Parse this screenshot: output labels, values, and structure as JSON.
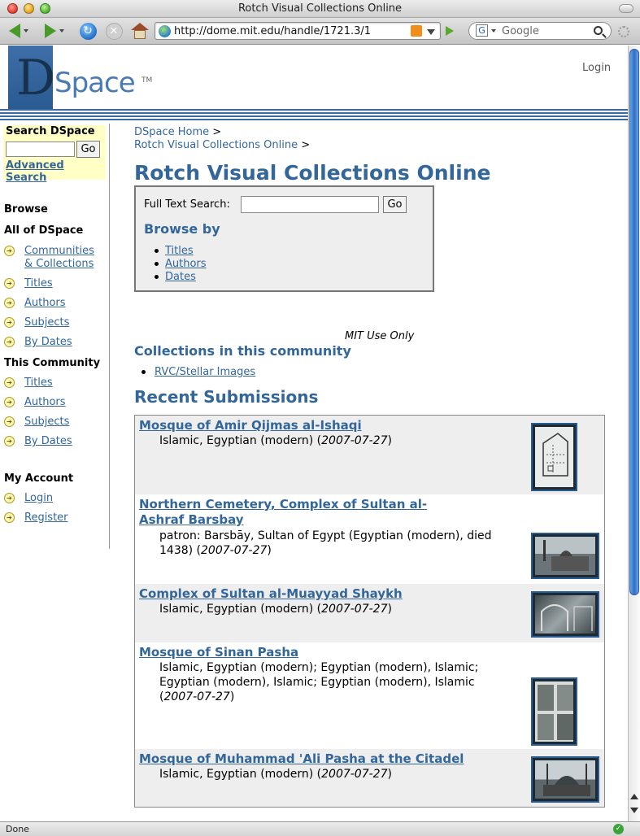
{
  "browser": {
    "window_title": "Rotch Visual Collections Online",
    "url": "http://dome.mit.edu/handle/1721.3/1",
    "search_placeholder": "Google",
    "status": "Done"
  },
  "header": {
    "logo_d": "D",
    "logo_space": "Space",
    "logo_tm": "TM",
    "login": "Login"
  },
  "sidebar": {
    "search_title": "Search DSpace",
    "go": "Go",
    "advanced": "Advanced Search",
    "browse": "Browse",
    "all_heading": "All of DSpace",
    "all_items": [
      "Communities",
      "& Collections",
      "Titles",
      "Authors",
      "Subjects",
      "By Dates"
    ],
    "community_heading": "This Community",
    "community_items": [
      "Titles",
      "Authors",
      "Subjects",
      "By Dates"
    ],
    "account_heading": "My Account",
    "account_items": [
      "Login",
      "Register"
    ]
  },
  "breadcrumb": {
    "home": "DSpace Home",
    "community": "Rotch Visual Collections Online",
    "sep": ">"
  },
  "main": {
    "title": "Rotch Visual Collections Online",
    "fts_label": "Full Text Search:",
    "go": "Go",
    "browse_by": "Browse by",
    "browse_links": [
      "Titles",
      "Authors",
      "Dates"
    ],
    "mit_use": "MIT Use Only",
    "collections_heading": "Collections in this community",
    "collections": [
      "RVC/Stellar Images"
    ],
    "recent_heading": "Recent Submissions",
    "recent": [
      {
        "title": "Mosque of Amir Qijmas al-Ishaqi",
        "desc": "Islamic, Egyptian (modern) (",
        "date": "2007-07-27",
        "close": ")"
      },
      {
        "title": "Northern Cemetery, Complex of Sultan al-Ashraf Barsbay",
        "desc": "patron: Barsbāy, Sultan of Egypt (Egyptian (modern), died 1438) (",
        "date": "2007-07-27",
        "close": ")"
      },
      {
        "title": "Complex of Sultan al-Muayyad Shaykh",
        "desc": "Islamic, Egyptian (modern) (",
        "date": "2007-07-27",
        "close": ")"
      },
      {
        "title": "Mosque of Sinan Pasha",
        "desc": "Islamic, Egyptian (modern); Egyptian (modern), Islamic; Egyptian (modern), Islamic; Egyptian (modern), Islamic (",
        "date": "2007-07-27",
        "close": ")"
      },
      {
        "title": "Mosque of Muhammad 'Ali Pasha at the Citadel",
        "desc": "Islamic, Egyptian (modern) (",
        "date": "2007-07-27",
        "close": ")"
      }
    ]
  }
}
